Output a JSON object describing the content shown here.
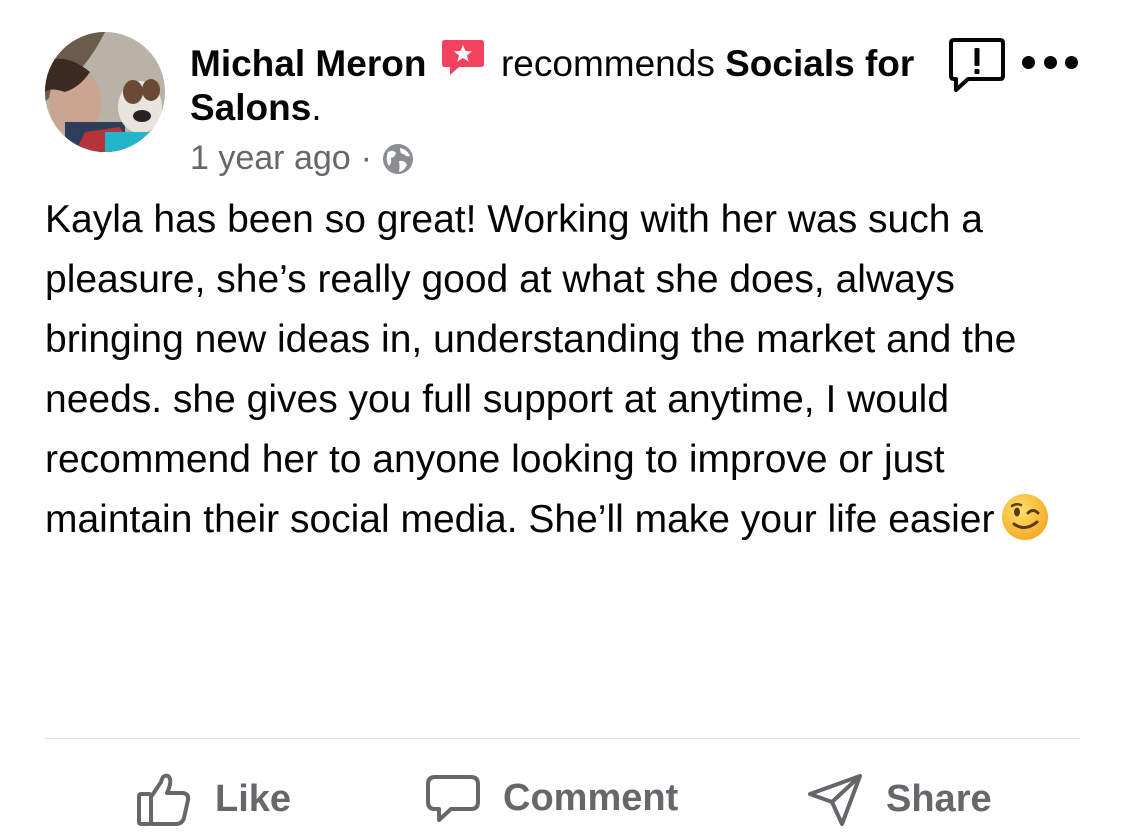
{
  "post": {
    "author": "Michal Meron",
    "verb": "recommends",
    "page_name": "Socials for Salons",
    "page_suffix": ".",
    "time": "1 year ago",
    "separator": "·",
    "privacy_icon": "globe-icon",
    "body_text": "Kayla has been so great! Working with her was such a pleasure, she’s really good at what she does, always bringing new ideas in, understanding the market and the needs. she gives you full support at anytime, I would recommend her to anyone looking to improve or just maintain their social media. She’ll make your life easier",
    "emoji": "winking-face-emoji"
  },
  "actions": {
    "like_label": "Like",
    "comment_label": "Comment",
    "share_label": "Share"
  },
  "colors": {
    "recommend_badge": "#f3425f",
    "secondary_text": "#65676b",
    "divider": "#dddfe2"
  }
}
